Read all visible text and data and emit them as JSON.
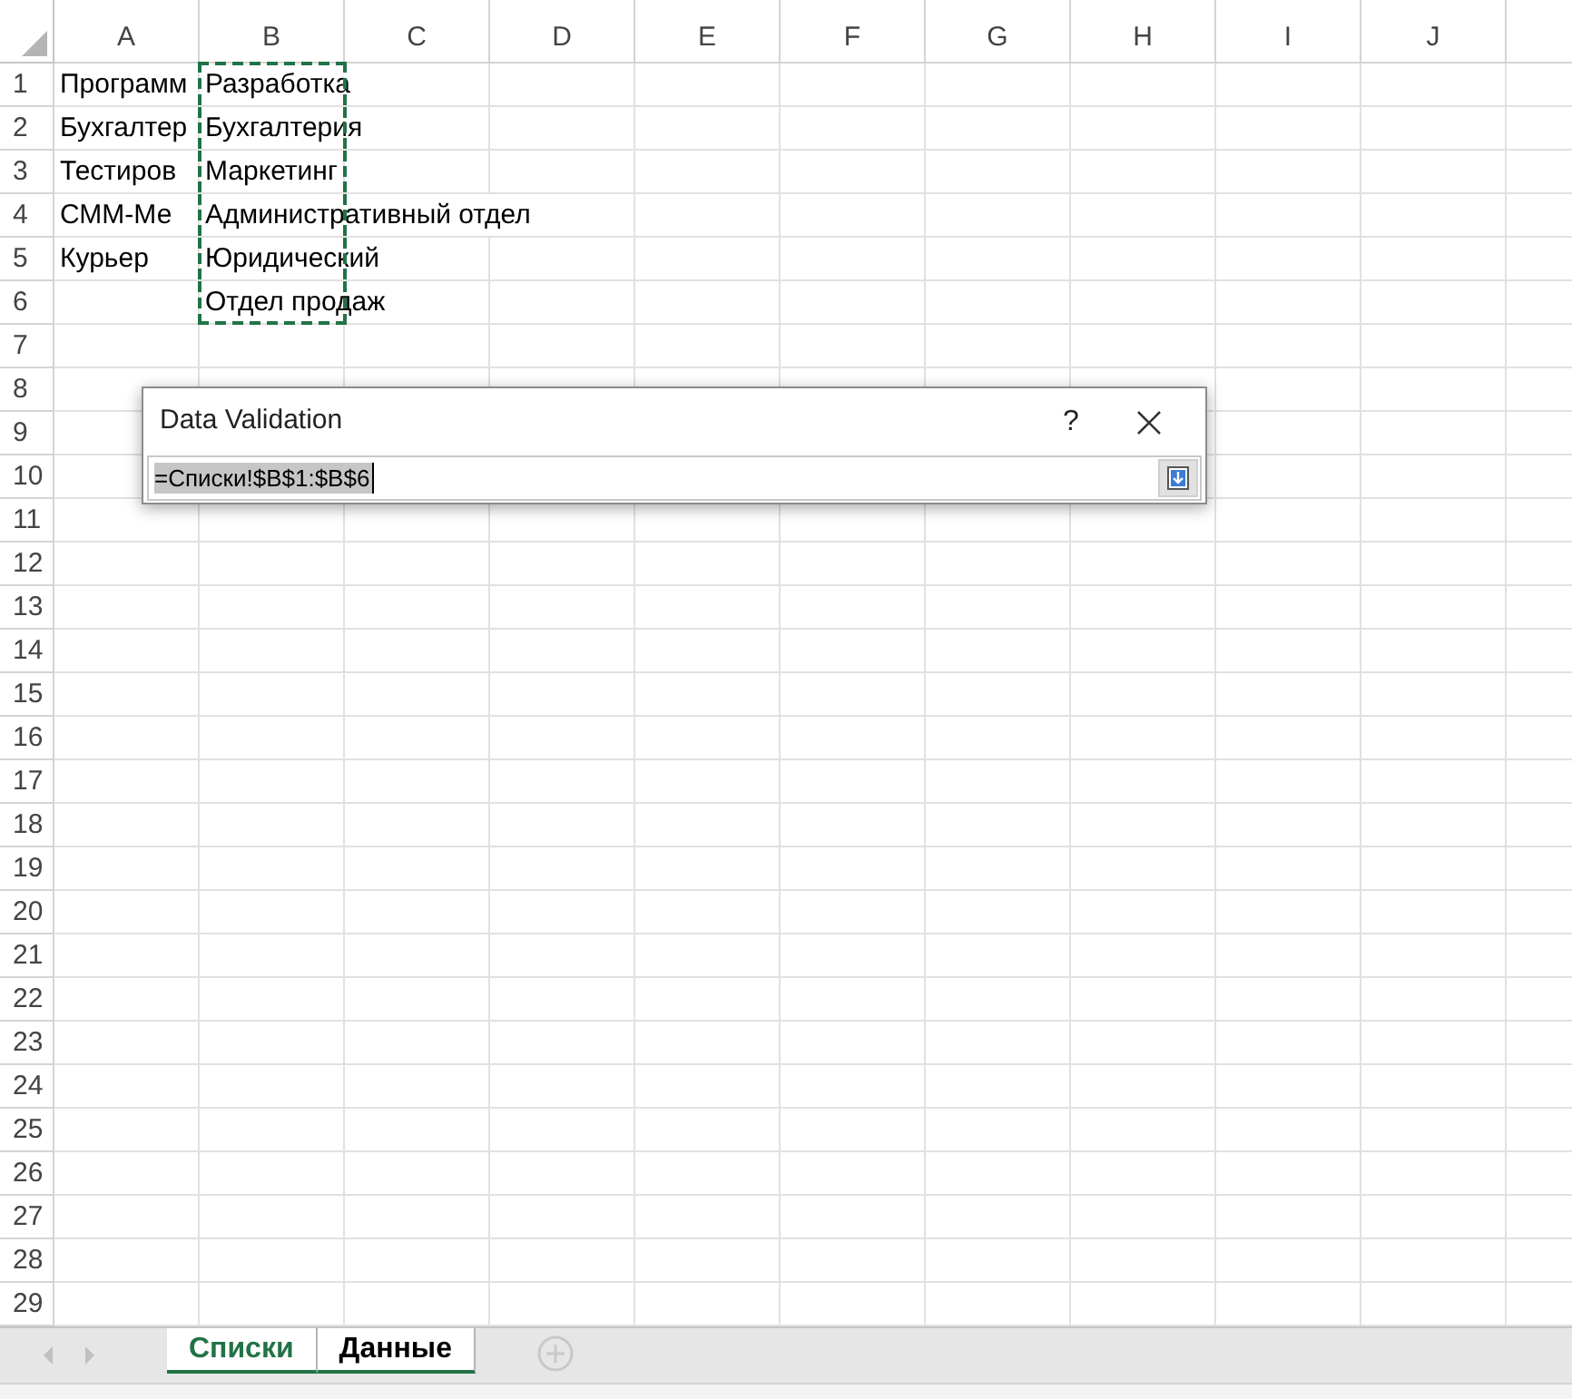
{
  "columns": [
    "A",
    "B",
    "C",
    "D",
    "E",
    "F",
    "G",
    "H",
    "I",
    "J"
  ],
  "rows": [
    {
      "header": "1",
      "cells": [
        {
          "text": "Программ",
          "marked": false
        },
        {
          "text": "Разработка",
          "marked": true
        }
      ]
    },
    {
      "header": "2",
      "cells": [
        {
          "text": "Бухгалтер",
          "marked": false
        },
        {
          "text": "Бухгалтерия",
          "marked": true
        }
      ]
    },
    {
      "header": "3",
      "cells": [
        {
          "text": "Тестиров",
          "marked": false
        },
        {
          "text": "Маркетинг",
          "marked": true
        }
      ]
    },
    {
      "header": "4",
      "cells": [
        {
          "text": "СММ-Ме",
          "marked": false
        },
        {
          "text": "Административный отдел",
          "marked": true
        }
      ]
    },
    {
      "header": "5",
      "cells": [
        {
          "text": "Курьер",
          "marked": false
        },
        {
          "text": "Юридический",
          "marked": true
        }
      ]
    },
    {
      "header": "6",
      "cells": [
        null,
        {
          "text": "Отдел продаж",
          "marked": true
        }
      ]
    },
    {
      "header": "7"
    },
    {
      "header": "8"
    },
    {
      "header": "9"
    },
    {
      "header": "10"
    },
    {
      "header": "11"
    },
    {
      "header": "12"
    },
    {
      "header": "13"
    },
    {
      "header": "14"
    },
    {
      "header": "15"
    },
    {
      "header": "16"
    },
    {
      "header": "17"
    },
    {
      "header": "18"
    },
    {
      "header": "19"
    },
    {
      "header": "20"
    },
    {
      "header": "21"
    },
    {
      "header": "22"
    },
    {
      "header": "23"
    },
    {
      "header": "24"
    },
    {
      "header": "25"
    },
    {
      "header": "26"
    },
    {
      "header": "27"
    },
    {
      "header": "28"
    },
    {
      "header": "29"
    }
  ],
  "dialog": {
    "title": "Data Validation",
    "help": "?",
    "value": "=Списки!$B$1:$B$6"
  },
  "sheet_tabs": [
    {
      "label": "Списки",
      "selected": true
    },
    {
      "label": "Данные",
      "selected": false
    }
  ]
}
